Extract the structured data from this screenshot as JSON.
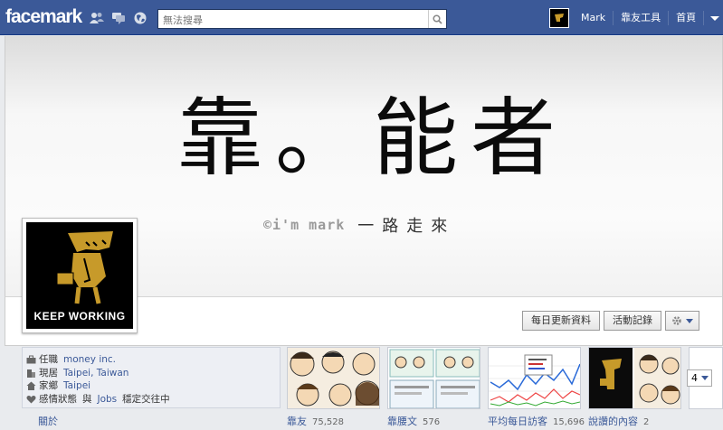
{
  "topbar": {
    "logo": "facemark",
    "search_placeholder": "無法搜尋",
    "user_name": "Mark",
    "nav_friends": "靠友工具",
    "nav_home": "首頁"
  },
  "cover": {
    "title": "靠。能者",
    "signature": "©i'm mark",
    "slogan": "一路走來"
  },
  "profile": {
    "caption": "KEEP WORKING"
  },
  "actions": {
    "update": "每日更新資料",
    "activity": "活動記錄"
  },
  "about": {
    "work_label": "任職",
    "work_value": "money inc.",
    "lives_label": "現居",
    "lives_value": "Taipei, Taiwan",
    "home_label": "家鄉",
    "home_value": "Taipei",
    "rel_label": "感情狀態",
    "rel_with": "與",
    "rel_name": "Jobs",
    "rel_status": "穩定交往中",
    "link": "關於"
  },
  "apps": [
    {
      "label": "靠友",
      "count": "75,528"
    },
    {
      "label": "靠腰文",
      "count": "576"
    },
    {
      "label": "平均每日訪客",
      "count": "15,696"
    },
    {
      "label": "說讚的內容",
      "count": "2"
    }
  ],
  "more_count": "4",
  "colors": {
    "brand": "#3b5998",
    "link": "#3b5998"
  }
}
